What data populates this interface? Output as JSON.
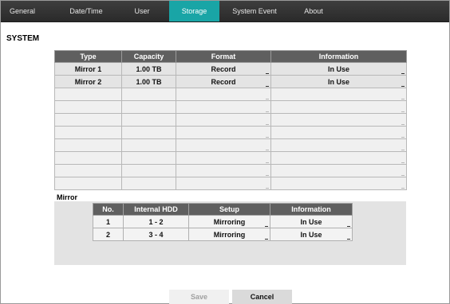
{
  "tabs": [
    {
      "label": "General",
      "active": false
    },
    {
      "label": "Date/Time",
      "active": false
    },
    {
      "label": "User",
      "active": false
    },
    {
      "label": "Storage",
      "active": true
    },
    {
      "label": "System Event",
      "active": false
    },
    {
      "label": "About",
      "active": false
    }
  ],
  "section_title": "SYSTEM",
  "storage_table": {
    "headers": [
      "Type",
      "Capacity",
      "Format",
      "Information"
    ],
    "rows": [
      {
        "type": "Mirror 1",
        "capacity": "1.00 TB",
        "format": "Record",
        "information": "In Use"
      },
      {
        "type": "Mirror 2",
        "capacity": "1.00 TB",
        "format": "Record",
        "information": "In Use"
      }
    ],
    "empty_rows": 8
  },
  "mirror": {
    "label": "Mirror",
    "headers": [
      "No.",
      "Internal HDD",
      "Setup",
      "Information"
    ],
    "rows": [
      {
        "no": "1",
        "internal_hdd": "1 - 2",
        "setup": "Mirroring",
        "information": "In Use"
      },
      {
        "no": "2",
        "internal_hdd": "3 - 4",
        "setup": "Mirroring",
        "information": "In Use"
      }
    ]
  },
  "buttons": {
    "save_label": "Save",
    "cancel_label": "Cancel"
  },
  "colors": {
    "active_tab": "#19a5a6",
    "tabbar": "#333333",
    "table_header": "#5f5f5f"
  }
}
